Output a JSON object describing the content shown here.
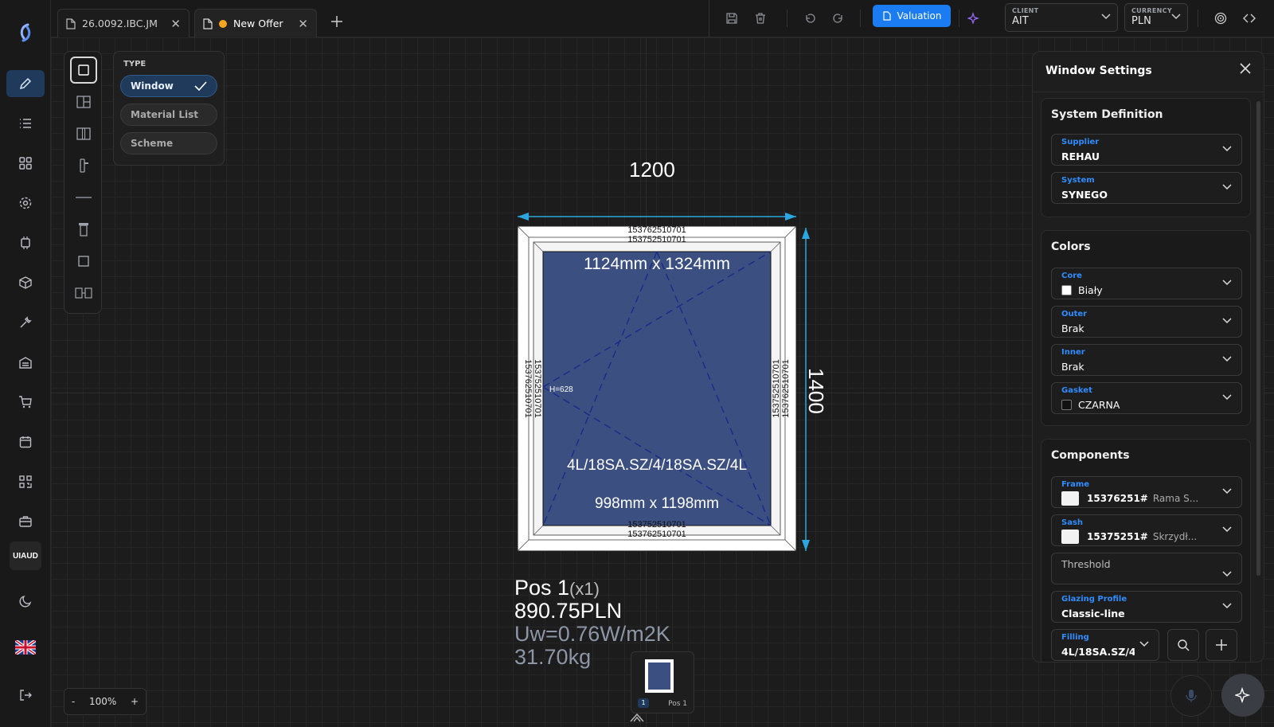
{
  "tabs": [
    {
      "label": "26.0092.IBC.JM",
      "active": false,
      "dirty": false
    },
    {
      "label": "New Offer",
      "active": true,
      "dirty": true
    }
  ],
  "toolbar": {
    "valuation_label": "Valuation",
    "client": {
      "label": "CLIENT",
      "value": "AIT"
    },
    "currency": {
      "label": "CURRENCY",
      "value": "PLN"
    }
  },
  "rail": {
    "user_initials": "UIAUD"
  },
  "type_panel": {
    "title": "TYPE",
    "options": [
      {
        "label": "Window",
        "selected": true
      },
      {
        "label": "Material List",
        "selected": false
      },
      {
        "label": "Scheme",
        "selected": false
      }
    ]
  },
  "drawing": {
    "width_dim": "1200",
    "height_dim": "1400",
    "profile_code_top": "153762510701",
    "profile_code_inner": "153752510701",
    "glass_dims": "1124mm x 1324mm",
    "sash_dims": "998mm x 1198mm",
    "glazing": "4L/18SA.SZ/4/18SA.SZ/4L",
    "handle_height": "H=628"
  },
  "position": {
    "name": "Pos 1",
    "multiplier": "(x1)",
    "price": "890.75PLN",
    "uw": "Uw=0.76W/m2K",
    "weight": "31.70kg",
    "thumb_badge": "1",
    "thumb_label": "Pos 1"
  },
  "zoom": {
    "minus": "-",
    "value": "100%",
    "plus": "+"
  },
  "settings": {
    "title": "Window Settings",
    "system_definition": {
      "title": "System Definition",
      "supplier": {
        "label": "Supplier",
        "value": "REHAU"
      },
      "system": {
        "label": "System",
        "value": "SYNEGO"
      }
    },
    "colors": {
      "title": "Colors",
      "core": {
        "label": "Core",
        "value": "Biały",
        "swatch": "#ffffff"
      },
      "outer": {
        "label": "Outer",
        "value": "Brak"
      },
      "inner": {
        "label": "Inner",
        "value": "Brak"
      },
      "gasket": {
        "label": "Gasket",
        "value": "CZARNA",
        "swatch": "#111111"
      }
    },
    "components": {
      "title": "Components",
      "frame": {
        "label": "Frame",
        "code": "15376251#",
        "desc": "Rama S..."
      },
      "sash": {
        "label": "Sash",
        "code": "15375251#",
        "desc": "Skrzydł..."
      },
      "threshold": {
        "placeholder": "Threshold"
      },
      "glazing_profile": {
        "label": "Glazing Profile",
        "value": "Classic-line"
      },
      "filling": {
        "label": "Filling",
        "value": "4L/18SA.SZ/4/"
      }
    }
  },
  "colors": {
    "accent": "#1a7cf0",
    "glass": "#3b4f80",
    "background": "#1c1c1c"
  }
}
